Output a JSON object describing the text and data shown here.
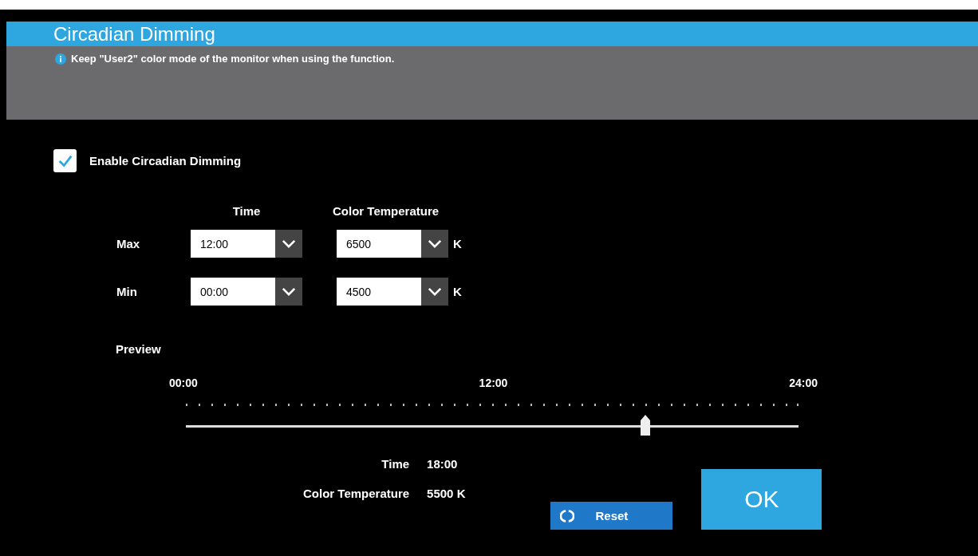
{
  "window": {
    "title": "Circadian Dimming"
  },
  "notice": {
    "text": "Keep \"User2\" color mode of the monitor when using the function."
  },
  "enable": {
    "label": "Enable Circadian Dimming",
    "checked": true
  },
  "settings": {
    "columns": [
      "Time",
      "Color Temperature"
    ],
    "rows": [
      {
        "label": "Max",
        "time": "12:00",
        "temperature": "6500",
        "unit": "K"
      },
      {
        "label": "Min",
        "time": "00:00",
        "temperature": "4500",
        "unit": "K"
      }
    ]
  },
  "preview": {
    "label": "Preview",
    "scale": [
      "00:00",
      "12:00",
      "24:00"
    ],
    "slider": {
      "level": 0.75
    },
    "readouts": [
      {
        "label": "Time",
        "value": "18:00"
      },
      {
        "label": "Color Temperature",
        "value": "5500 K"
      }
    ]
  },
  "buttons": {
    "reset": "Reset",
    "ok": "OK"
  }
}
